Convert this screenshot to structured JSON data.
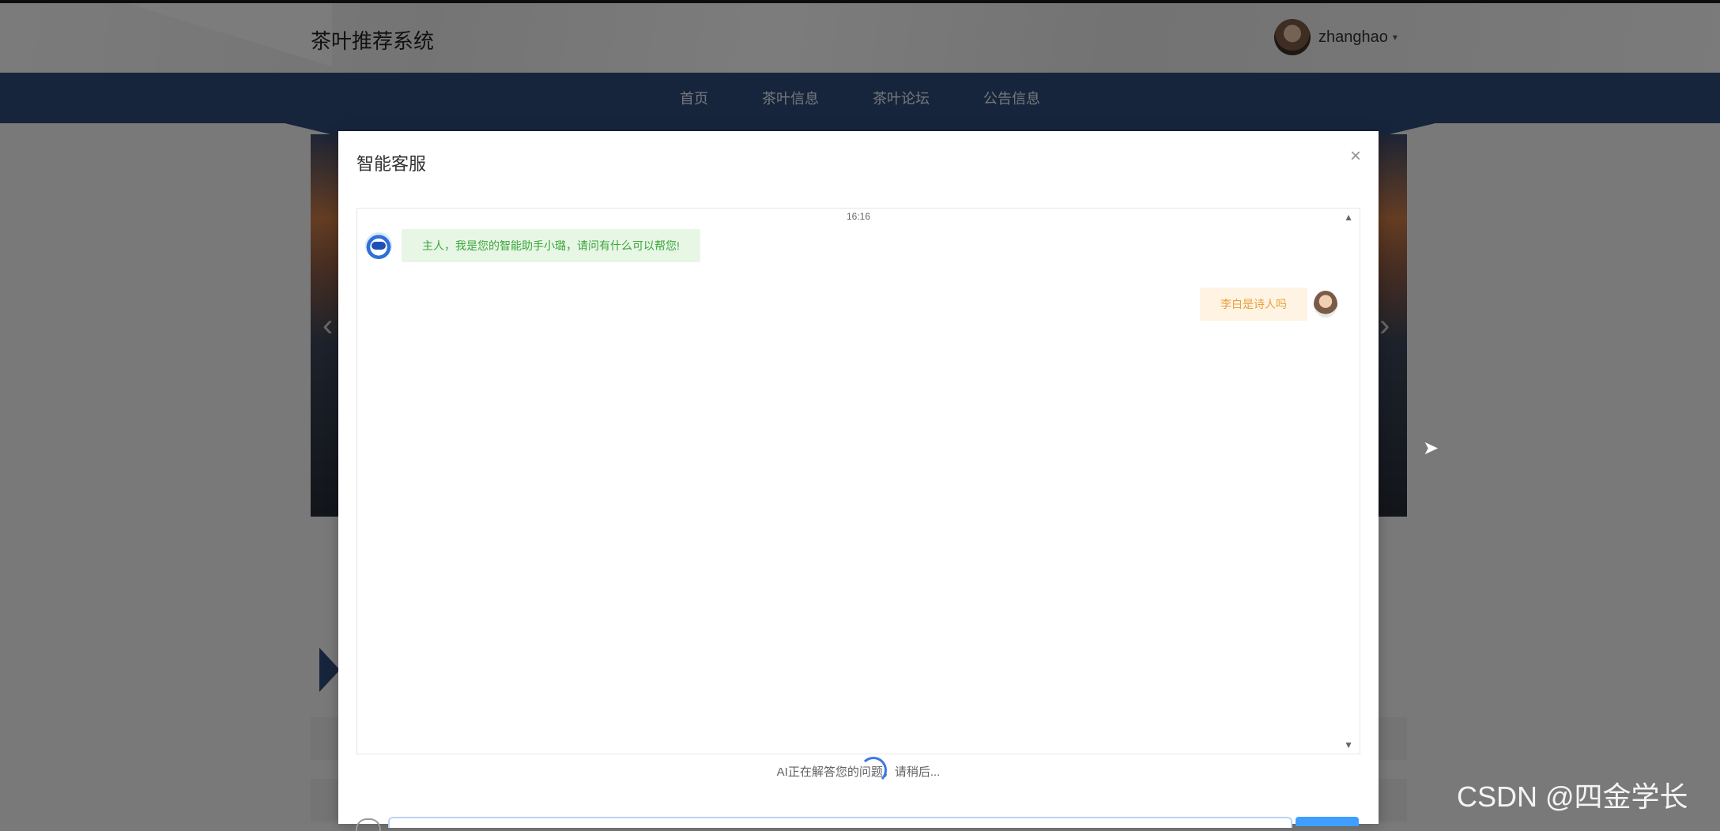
{
  "site": {
    "title": "茶叶推荐系统"
  },
  "user": {
    "name": "zhanghao",
    "caret": "▾"
  },
  "nav": {
    "items": [
      "首页",
      "茶叶信息",
      "茶叶论坛",
      "公告信息"
    ]
  },
  "banner": {
    "prev_arrow": "‹",
    "next_arrow": "›"
  },
  "modal": {
    "title": "智能客服",
    "close": "×",
    "chat": {
      "time": "16:16",
      "bot_message": "主人，我是您的智能助手小璐，请问有什么可以帮您!",
      "user_message": "李白是诗人吗"
    },
    "status_text": "AI正在解答您的问题，请稍后...",
    "scroll_up": "▲",
    "scroll_down": "▼"
  },
  "watermark": "CSDN @四金学长",
  "colors": {
    "nav_bg": "#2e4a78",
    "bot_bubble_bg": "#e8f6e6",
    "bot_text": "#3aa63a",
    "user_bubble_bg": "#fff4e3",
    "user_text": "#e6a23c",
    "send_button": "#409eff"
  },
  "icons": {
    "close": "close-icon",
    "bot_avatar": "customer-service-icon",
    "caret": "chevron-down-icon",
    "loading": "spinner-icon",
    "cursor": "mouse-pointer-icon"
  }
}
